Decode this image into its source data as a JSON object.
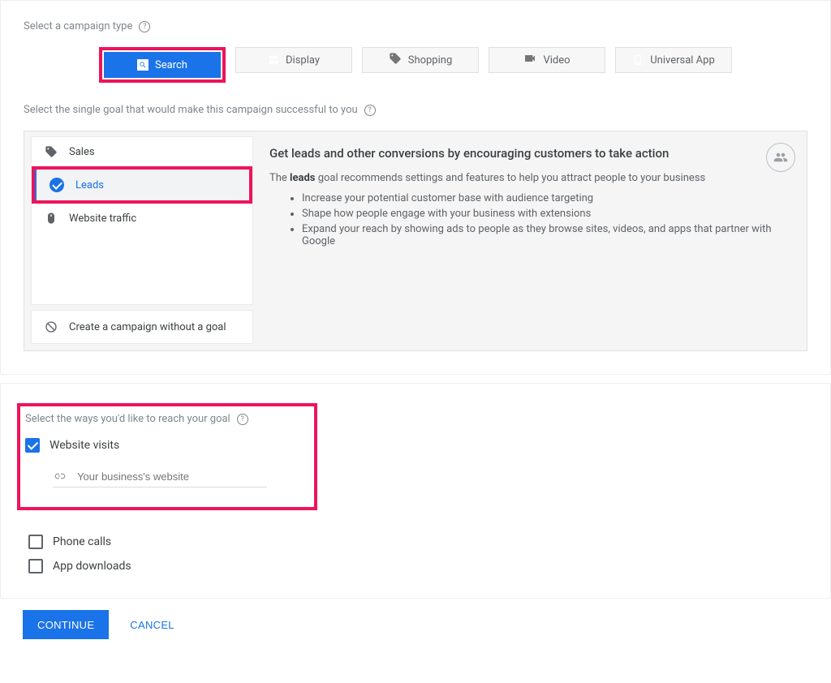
{
  "section1": {
    "title": "Select a campaign type",
    "tabs": {
      "search": "Search",
      "display": "Display",
      "shopping": "Shopping",
      "video": "Video",
      "universal": "Universal App"
    }
  },
  "section2": {
    "title": "Select the single goal that would make this campaign successful to you",
    "goals": {
      "sales": "Sales",
      "leads": "Leads",
      "traffic": "Website traffic",
      "no_goal": "Create a campaign without a goal"
    },
    "desc": {
      "heading": "Get leads and other conversions by encouraging customers to take action",
      "intro_prefix": "The ",
      "intro_bold": "leads",
      "intro_suffix": " goal recommends settings and features to help you attract people to your business",
      "bullets": {
        "b1": "Increase your potential customer base with audience targeting",
        "b2": "Shape how people engage with your business with extensions",
        "b3": "Expand your reach by showing ads to people as they browse sites, videos, and apps that partner with Google"
      }
    }
  },
  "section3": {
    "title": "Select the ways you'd like to reach your goal",
    "options": {
      "website_visits": "Website visits",
      "website_placeholder": "Your business's website",
      "phone_calls": "Phone calls",
      "app_downloads": "App downloads"
    }
  },
  "footer": {
    "continue": "CONTINUE",
    "cancel": "CANCEL"
  }
}
